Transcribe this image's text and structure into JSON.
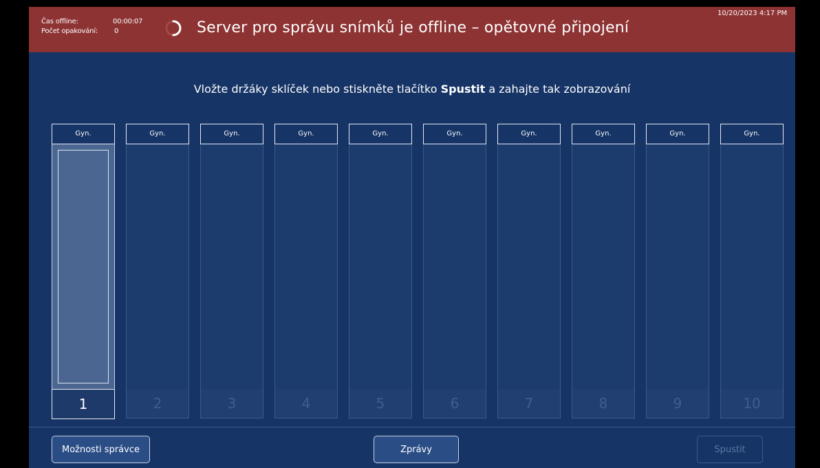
{
  "header": {
    "offline_time_label": "Čas offline:",
    "offline_time_value": "00:00:07",
    "retry_count_label": "Počet opakování:",
    "retry_count_value": "0",
    "title": "Server pro správu snímků je offline – opětovné připojení",
    "datetime": "10/20/2023 4:17 PM"
  },
  "instruction": {
    "before": "Vložte držáky sklíček nebo stiskněte tlačítko ",
    "bold": "Spustit",
    "after": " a zahajte tak zobrazování"
  },
  "slots": [
    {
      "label": "Gyn.",
      "number": "1"
    },
    {
      "label": "Gyn.",
      "number": "2"
    },
    {
      "label": "Gyn.",
      "number": "3"
    },
    {
      "label": "Gyn.",
      "number": "4"
    },
    {
      "label": "Gyn.",
      "number": "5"
    },
    {
      "label": "Gyn.",
      "number": "6"
    },
    {
      "label": "Gyn.",
      "number": "7"
    },
    {
      "label": "Gyn.",
      "number": "8"
    },
    {
      "label": "Gyn.",
      "number": "9"
    },
    {
      "label": "Gyn.",
      "number": "10"
    }
  ],
  "footer": {
    "admin_label": "Možnosti správce",
    "messages_label": "Zprávy",
    "start_label": "Spustit"
  },
  "colors": {
    "header_bg": "#8d3333",
    "screen_bg": "#163466",
    "active_slot_fill": "#4c6692"
  },
  "icons": {
    "spinner": "loading-spinner-icon"
  }
}
